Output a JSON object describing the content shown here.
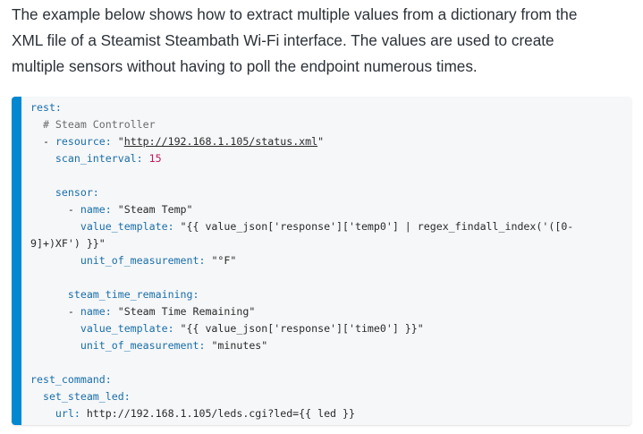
{
  "intro": {
    "line1": "The example below shows how to extract multiple values from a dictionary from the",
    "line2": "XML file of a Steamist Steambath Wi-Fi interface. The values are used to create",
    "line3": "multiple sensors without having to poll the endpoint numerous times."
  },
  "code": {
    "l1_key": "rest:",
    "l2_comment": "# Steam Controller",
    "l3_dash": "- ",
    "l3_key": "resource:",
    "l3_q1": "\"",
    "l3_url": "http://192.168.1.105/status.xml",
    "l3_q2": "\"",
    "l4_key": "scan_interval:",
    "l4_val": "15",
    "l6_key": "sensor:",
    "l7_dash": "- ",
    "l7_key": "name:",
    "l7_val": "\"Steam Temp\"",
    "l8_key": "value_template:",
    "l8_val": "\"{{ value_json['response']['temp0'] | regex_findall_index('([0-",
    "l9_val": "9]+)XF') }}\"",
    "l10_key": "unit_of_measurement:",
    "l10_val": "\"°F\"",
    "l12_key": "steam_time_remaining:",
    "l13_dash": "- ",
    "l13_key": "name:",
    "l13_val": "\"Steam Time Remaining\"",
    "l14_key": "value_template:",
    "l14_val": "\"{{ value_json['response']['time0'] }}\"",
    "l15_key": "unit_of_measurement:",
    "l15_val": "\"minutes\"",
    "l17_key": "rest_command:",
    "l18_key": "set_steam_led:",
    "l19_key": "url:",
    "l19_val": "http://192.168.1.105/leds.cgi?led={{ led }}"
  },
  "colors": {
    "accent_bar": "#0288d1",
    "code_background": "#f5f7f9",
    "yaml_key": "#1a6ea8",
    "number": "#c2185b"
  }
}
